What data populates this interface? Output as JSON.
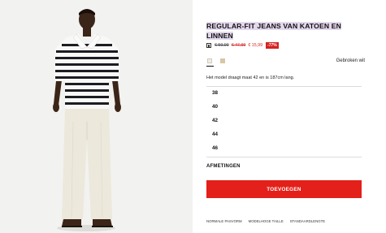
{
  "product": {
    "title": "REGULAR-FIT JEANS VAN KATOEN EN LINNEN",
    "old_price": "€ 59,99",
    "mid_price": "€ 47,99",
    "new_price": "€ 15,99",
    "discount": "-77%"
  },
  "colors": {
    "selected_name": "Gebroken wit",
    "swatches": [
      {
        "name": "gebroken-wit",
        "hex": "#f1ede3"
      },
      {
        "name": "beige",
        "hex": "#d8c7a5"
      }
    ]
  },
  "model_note": "Het model draagt maat 42 en is 187cm lang.",
  "sizes": [
    "38",
    "40",
    "42",
    "44",
    "46"
  ],
  "afmetingen_label": "AFMETINGEN",
  "add_button_label": "TOEVOEGEN",
  "footer_links": [
    "NORMALE PASVORM",
    "MODELHOGE TAILLE",
    "STANDAARDLENGTE"
  ],
  "theme": {
    "accent": "#e32019",
    "sale": "#d32222",
    "highlight": "#e3d8ec"
  }
}
